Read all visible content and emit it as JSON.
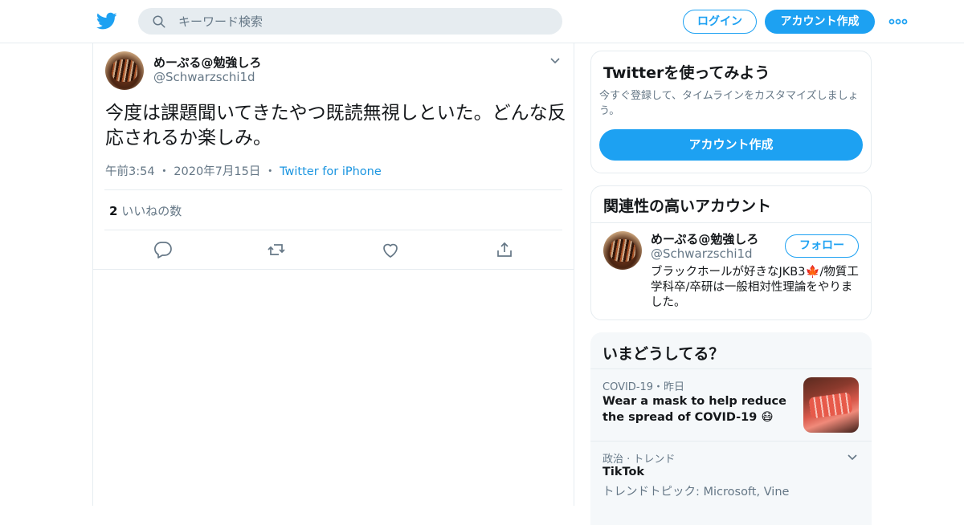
{
  "header": {
    "search_placeholder": "キーワード検索",
    "login_label": "ログイン",
    "signup_label": "アカウント作成"
  },
  "tweet": {
    "author_name": "めーぷる@勉強しろ",
    "author_handle": "@Schwarzschi1d",
    "text": "今度は課題聞いてきたやつ既読無視しといた。どんな反応されるか楽しみ。",
    "time": "午前3:54",
    "date": "2020年7月15日",
    "source": "Twitter for iPhone",
    "like_count": "2",
    "like_label": "いいねの数"
  },
  "sidebar": {
    "promo": {
      "title": "Twitterを使ってみよう",
      "description": "今すぐ登録して、タイムラインをカスタマイズしましょう。",
      "button_label": "アカウント作成"
    },
    "related": {
      "title": "関連性の高いアカウント",
      "account": {
        "name": "めーぷる@勉強しろ",
        "handle": "@Schwarzschi1d",
        "follow_label": "フォロー",
        "bio": "ブラックホールが好きなJKB3🍁/物質工学科卒/卒研は一般相対性理論をやりました。"
      }
    },
    "trends": {
      "title": "いまどうしてる？",
      "items": [
        {
          "meta": "COVID-19・昨日",
          "title": "Wear a mask to help reduce the spread of COVID-19 😷"
        },
        {
          "meta": "政治 · トレンド",
          "title": "TikTok",
          "subtitle": "トレンドトピック: Microsoft, Vine"
        }
      ]
    }
  },
  "colors": {
    "accent": "#1da1f2",
    "link": "#1b95e0",
    "muted": "#657786",
    "border": "#e6ecf0"
  },
  "icons": {
    "logo": "twitter-bird-icon",
    "search": "search-icon",
    "more": "more-dots-icon",
    "caret": "chevron-down-icon",
    "reply": "reply-icon",
    "retweet": "retweet-icon",
    "like": "heart-icon",
    "share": "share-icon"
  }
}
